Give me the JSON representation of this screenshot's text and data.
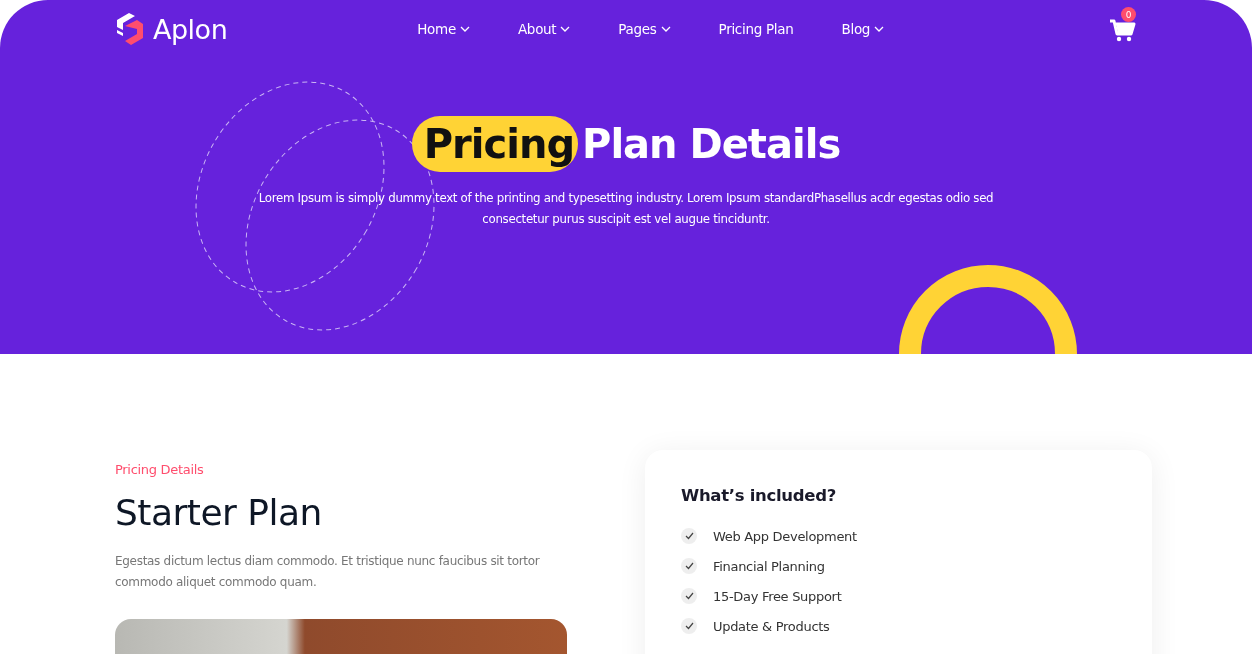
{
  "header": {
    "logo_text": "Aplon",
    "nav": [
      {
        "label": "Home",
        "has_dropdown": true
      },
      {
        "label": "About",
        "has_dropdown": true
      },
      {
        "label": "Pages",
        "has_dropdown": true
      },
      {
        "label": "Pricing Plan",
        "has_dropdown": false
      },
      {
        "label": "Blog",
        "has_dropdown": true
      }
    ],
    "cart_count": "0"
  },
  "hero": {
    "title_highlight": "Pricing",
    "title_rest": "Plan Details",
    "description": "Lorem Ipsum is simply dummy text of the printing and typesetting industry. Lorem Ipsum standardPhasellus acdr egestas odio sed consectetur purus suscipit est vel augue tinciduntr."
  },
  "plan": {
    "eyebrow": "Pricing Details",
    "title": "Starter Plan",
    "description": "Egestas dictum lectus diam commodo. Et tristique nunc faucibus sit tortor commodo aliquet commodo quam."
  },
  "included": {
    "title": "What’s included?",
    "items": [
      {
        "label": "Web App Development",
        "checked": true
      },
      {
        "label": "Financial Planning",
        "checked": true
      },
      {
        "label": "15-Day Free Support",
        "checked": true
      },
      {
        "label": "Update & Products",
        "checked": true
      }
    ]
  }
}
